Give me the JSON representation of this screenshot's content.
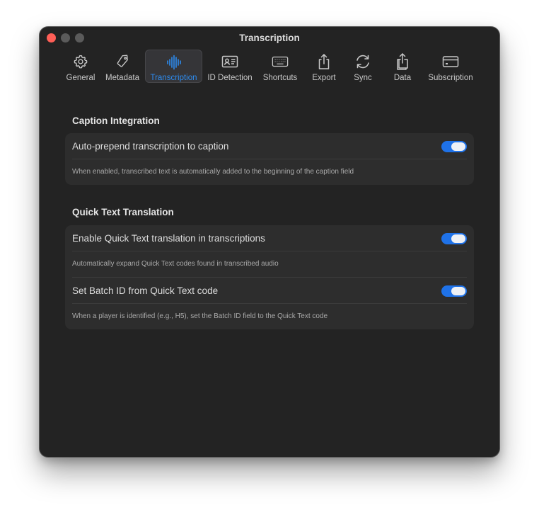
{
  "window": {
    "title": "Transcription"
  },
  "toolbar": {
    "tabs": [
      {
        "label": "General",
        "icon": "gear-icon",
        "active": false
      },
      {
        "label": "Metadata",
        "icon": "tag-icon",
        "active": false
      },
      {
        "label": "Transcription",
        "icon": "waveform-icon",
        "active": true
      },
      {
        "label": "ID Detection",
        "icon": "id-card-icon",
        "active": false
      },
      {
        "label": "Shortcuts",
        "icon": "keyboard-icon",
        "active": false
      },
      {
        "label": "Export",
        "icon": "share-icon",
        "active": false
      },
      {
        "label": "Sync",
        "icon": "sync-icon",
        "active": false
      },
      {
        "label": "Data",
        "icon": "data-share-icon",
        "active": false
      },
      {
        "label": "Subscription",
        "icon": "credit-card-icon",
        "active": false
      }
    ]
  },
  "caption_integration": {
    "title": "Caption Integration",
    "auto_prepend": {
      "label": "Auto-prepend transcription to caption",
      "description": "When enabled, transcribed text is automatically added to the beginning of the caption field",
      "enabled": true
    }
  },
  "quick_text": {
    "title": "Quick Text Translation",
    "enable_translation": {
      "label": "Enable Quick Text translation in transcriptions",
      "description": "Automatically expand Quick Text codes found in transcribed audio",
      "enabled": true
    },
    "batch_id": {
      "label": "Set Batch ID from Quick Text code",
      "description": "When a player is identified (e.g., H5), set the Batch ID field to the Quick Text code",
      "enabled": true
    }
  },
  "colors": {
    "accent": "#1f72e8",
    "active_tab_text": "#2d8cf0",
    "window_bg": "#232323",
    "card_bg": "#2d2d2d"
  }
}
